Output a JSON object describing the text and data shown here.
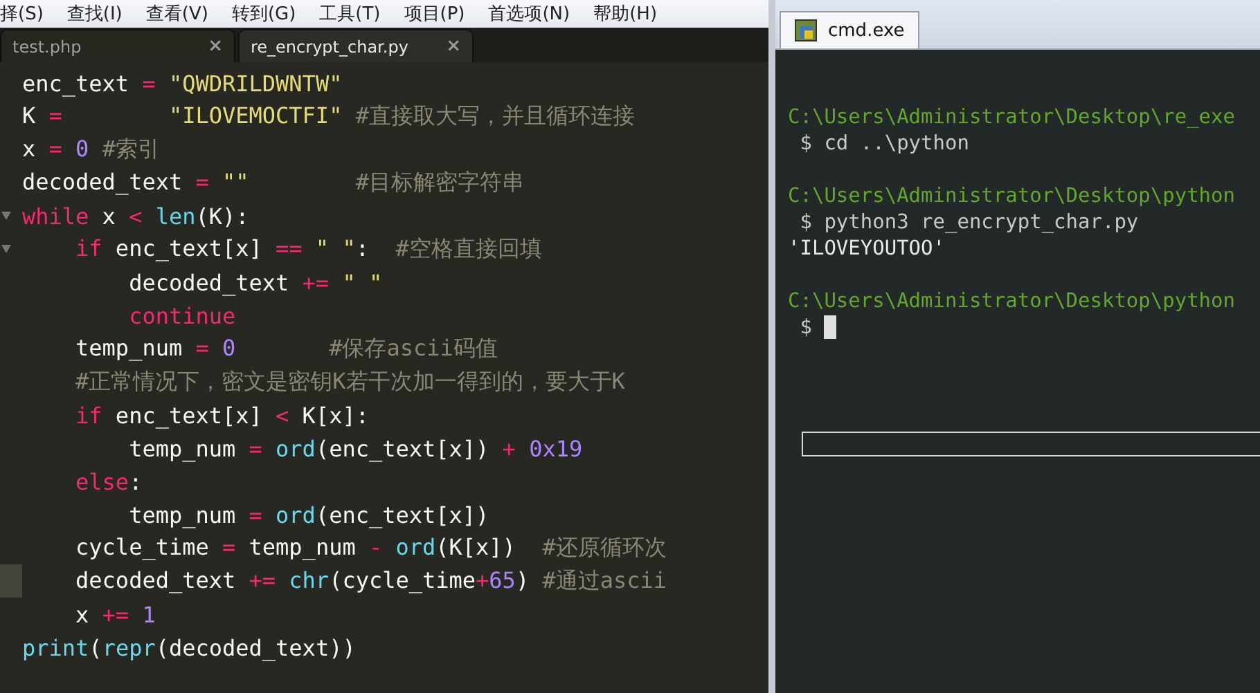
{
  "menu": [
    {
      "label": "择(S)"
    },
    {
      "label": "查找(I)"
    },
    {
      "label": "查看(V)"
    },
    {
      "label": "转到(G)"
    },
    {
      "label": "工具(T)"
    },
    {
      "label": "项目(P)"
    },
    {
      "label": "首选项(N)"
    },
    {
      "label": "帮助(H)"
    }
  ],
  "tabs": [
    {
      "label": "test.php",
      "selected": false,
      "close": "×"
    },
    {
      "label": "re_encrypt_char.py",
      "selected": true,
      "close": "×"
    }
  ],
  "code": [
    {
      "fold": false,
      "current": false,
      "tokens": [
        {
          "kind": "plain",
          "text": "enc_text "
        },
        {
          "kind": "op",
          "text": "="
        },
        {
          "kind": "string",
          "text": " \"QWDRILDWNTW\""
        }
      ]
    },
    {
      "fold": false,
      "current": false,
      "tokens": [
        {
          "kind": "plain",
          "text": "K "
        },
        {
          "kind": "op",
          "text": "="
        },
        {
          "kind": "string",
          "text": "        \"ILOVEMOCTFI\" "
        },
        {
          "kind": "comment",
          "text": "#直接取大写，并且循环连接"
        }
      ]
    },
    {
      "fold": false,
      "current": false,
      "tokens": [
        {
          "kind": "plain",
          "text": "x "
        },
        {
          "kind": "op",
          "text": "="
        },
        {
          "kind": "number",
          "text": " 0 "
        },
        {
          "kind": "comment",
          "text": "#索引"
        }
      ]
    },
    {
      "fold": false,
      "current": false,
      "tokens": [
        {
          "kind": "plain",
          "text": "decoded_text "
        },
        {
          "kind": "op",
          "text": "="
        },
        {
          "kind": "string",
          "text": " \"\"        "
        },
        {
          "kind": "comment",
          "text": "#目标解密字符串"
        }
      ]
    },
    {
      "fold": true,
      "current": false,
      "tokens": [
        {
          "kind": "keyword",
          "text": "while"
        },
        {
          "kind": "plain",
          "text": " x "
        },
        {
          "kind": "op",
          "text": "<"
        },
        {
          "kind": "builtin",
          "text": " len"
        },
        {
          "kind": "plain",
          "text": "(K):"
        }
      ]
    },
    {
      "fold": true,
      "current": false,
      "tokens": [
        {
          "kind": "keyword",
          "text": "    if"
        },
        {
          "kind": "plain",
          "text": " enc_text[x] "
        },
        {
          "kind": "op",
          "text": "=="
        },
        {
          "kind": "string",
          "text": " \" \""
        },
        {
          "kind": "plain",
          "text": ":  "
        },
        {
          "kind": "comment",
          "text": "#空格直接回填"
        }
      ]
    },
    {
      "fold": false,
      "current": false,
      "tokens": [
        {
          "kind": "plain",
          "text": "        decoded_text "
        },
        {
          "kind": "op",
          "text": "+="
        },
        {
          "kind": "string",
          "text": " \" \""
        }
      ]
    },
    {
      "fold": false,
      "current": false,
      "tokens": [
        {
          "kind": "keyword",
          "text": "        continue"
        }
      ]
    },
    {
      "fold": false,
      "current": false,
      "tokens": [
        {
          "kind": "plain",
          "text": "    temp_num "
        },
        {
          "kind": "op",
          "text": "="
        },
        {
          "kind": "number",
          "text": " 0       "
        },
        {
          "kind": "comment",
          "text": "#保存ascii码值"
        }
      ]
    },
    {
      "fold": false,
      "current": false,
      "tokens": [
        {
          "kind": "comment",
          "text": "    #正常情况下，密文是密钥K若干次加一得到的，要大于K"
        }
      ]
    },
    {
      "fold": false,
      "current": false,
      "tokens": [
        {
          "kind": "keyword",
          "text": "    if"
        },
        {
          "kind": "plain",
          "text": " enc_text[x] "
        },
        {
          "kind": "op",
          "text": "<"
        },
        {
          "kind": "plain",
          "text": " K[x]:"
        }
      ]
    },
    {
      "fold": false,
      "current": false,
      "tokens": [
        {
          "kind": "plain",
          "text": "        temp_num "
        },
        {
          "kind": "op",
          "text": "="
        },
        {
          "kind": "builtin",
          "text": " ord"
        },
        {
          "kind": "plain",
          "text": "(enc_text[x]) "
        },
        {
          "kind": "op",
          "text": "+"
        },
        {
          "kind": "number",
          "text": " 0x19"
        }
      ]
    },
    {
      "fold": false,
      "current": false,
      "tokens": [
        {
          "kind": "keyword",
          "text": "    else"
        },
        {
          "kind": "plain",
          "text": ":"
        }
      ]
    },
    {
      "fold": false,
      "current": false,
      "tokens": [
        {
          "kind": "plain",
          "text": "        temp_num "
        },
        {
          "kind": "op",
          "text": "="
        },
        {
          "kind": "builtin",
          "text": " ord"
        },
        {
          "kind": "plain",
          "text": "(enc_text[x])"
        }
      ]
    },
    {
      "fold": false,
      "current": false,
      "tokens": [
        {
          "kind": "plain",
          "text": "    cycle_time "
        },
        {
          "kind": "op",
          "text": "="
        },
        {
          "kind": "plain",
          "text": " temp_num "
        },
        {
          "kind": "op",
          "text": "-"
        },
        {
          "kind": "builtin",
          "text": " ord"
        },
        {
          "kind": "plain",
          "text": "(K[x])  "
        },
        {
          "kind": "comment",
          "text": "#还原循环次"
        }
      ]
    },
    {
      "fold": false,
      "current": true,
      "tokens": [
        {
          "kind": "plain",
          "text": "    decoded_text "
        },
        {
          "kind": "op",
          "text": "+="
        },
        {
          "kind": "builtin",
          "text": " chr"
        },
        {
          "kind": "plain",
          "text": "(cycle_time"
        },
        {
          "kind": "op",
          "text": "+"
        },
        {
          "kind": "number",
          "text": "65"
        },
        {
          "kind": "plain",
          "text": ") "
        },
        {
          "kind": "comment",
          "text": "#通过ascii"
        }
      ]
    },
    {
      "fold": false,
      "current": false,
      "tokens": [
        {
          "kind": "plain",
          "text": "    x "
        },
        {
          "kind": "op",
          "text": "+="
        },
        {
          "kind": "number",
          "text": " 1"
        }
      ]
    },
    {
      "fold": false,
      "current": false,
      "tokens": [
        {
          "kind": "builtin",
          "text": "print"
        },
        {
          "kind": "plain",
          "text": "("
        },
        {
          "kind": "builtin",
          "text": "repr"
        },
        {
          "kind": "plain",
          "text": "(decoded_text))"
        }
      ]
    }
  ],
  "terminal": {
    "tab": "cmd.exe",
    "lines": [
      {
        "kind": "blank"
      },
      {
        "kind": "path",
        "text": "C:\\Users\\Administrator\\Desktop\\re_exe"
      },
      {
        "kind": "command",
        "text": " $ cd ..\\python"
      },
      {
        "kind": "blank"
      },
      {
        "kind": "path",
        "text": "C:\\Users\\Administrator\\Desktop\\python"
      },
      {
        "kind": "command",
        "text": " $ python3 re_encrypt_char.py"
      },
      {
        "kind": "output",
        "text": "'ILOVEYOUTOO'"
      },
      {
        "kind": "blank"
      },
      {
        "kind": "path",
        "text": "C:\\Users\\Administrator\\Desktop\\python"
      },
      {
        "kind": "prompt",
        "text": " $"
      }
    ]
  }
}
